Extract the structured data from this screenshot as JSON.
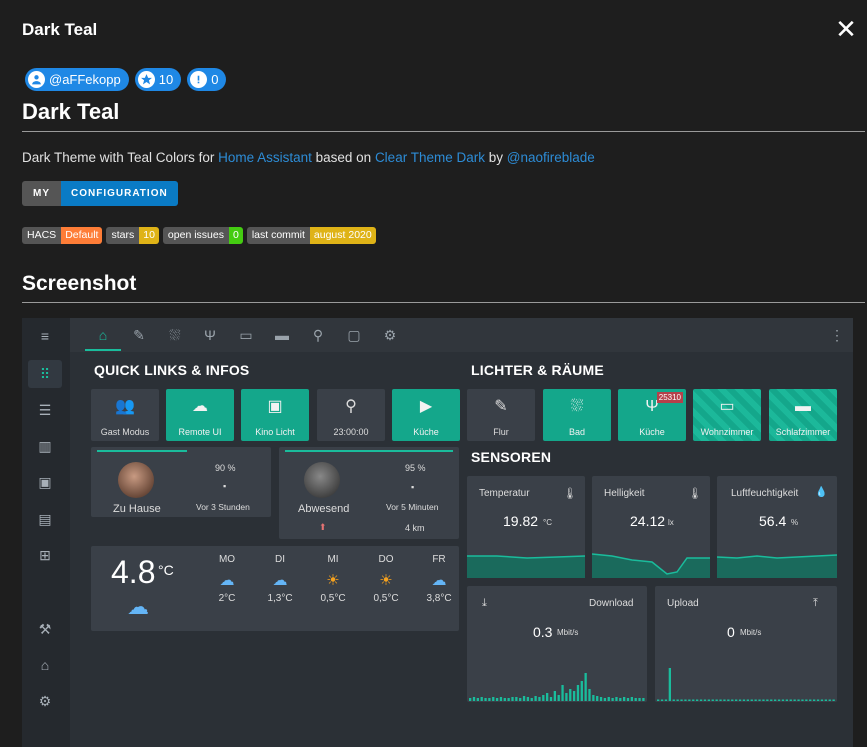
{
  "window": {
    "title": "Dark Teal",
    "close_icon": "close-icon"
  },
  "chips": [
    {
      "icon": "user-icon",
      "label": "@aFFekopp"
    },
    {
      "icon": "star-icon",
      "label": "10"
    },
    {
      "icon": "alert-icon",
      "label": "0"
    }
  ],
  "heading": "Dark Teal",
  "description": {
    "prefix": "Dark Theme with Teal Colors for ",
    "link1": "Home Assistant",
    "mid1": " based on ",
    "link2": "Clear Theme Dark",
    "mid2": " by ",
    "link3": "@naofireblade"
  },
  "my_config": {
    "left": "MY",
    "right": "CONFIGURATION"
  },
  "shields": [
    {
      "label": "HACS",
      "value": "Default",
      "color": "#fe7d37"
    },
    {
      "label": "stars",
      "value": "10",
      "color": "#dfb317"
    },
    {
      "label": "open issues",
      "value": "0",
      "color": "#4c1"
    },
    {
      "label": "last commit",
      "value": "august 2020",
      "color": "#dfb317"
    }
  ],
  "screenshot_heading": "Screenshot",
  "shot": {
    "accent": "#1abc9c",
    "quick_title": "QUICK LINKS & INFOS",
    "lights_title": "LICHTER & RÄUME",
    "sensors_title": "SENSOREN",
    "quick_buttons": [
      {
        "label": "Gast Modus",
        "style": "g"
      },
      {
        "label": "Remote UI",
        "style": "t"
      },
      {
        "label": "Kino Licht",
        "style": "t"
      },
      {
        "label": "23:00:00",
        "style": "g"
      },
      {
        "label": "Küche",
        "style": "t"
      }
    ],
    "room_buttons": [
      {
        "label": "Flur",
        "style": "g"
      },
      {
        "label": "Bad",
        "style": "t"
      },
      {
        "label": "Küche",
        "style": "t",
        "badge": "25310"
      },
      {
        "label": "Wohnzimmer",
        "style": "t"
      },
      {
        "label": "Schlafzimmer",
        "style": "t"
      }
    ],
    "persons": [
      {
        "name": "Zu Hause",
        "battery": "90 %",
        "since": "Vor 3 Stunden",
        "extra": ""
      },
      {
        "name": "Abwesend",
        "battery": "95 %",
        "since": "Vor 5 Minuten",
        "extra": "4 km"
      }
    ],
    "weather": {
      "temp": "4.8",
      "unit": "°C",
      "days": [
        {
          "d": "MO",
          "t": "2°C",
          "icon": "cloud"
        },
        {
          "d": "DI",
          "t": "1,3°C",
          "icon": "cloud"
        },
        {
          "d": "MI",
          "t": "0,5°C",
          "icon": "sun"
        },
        {
          "d": "DO",
          "t": "0,5°C",
          "icon": "sun"
        },
        {
          "d": "FR",
          "t": "3,8°C",
          "icon": "cloud"
        }
      ]
    },
    "sensors": [
      {
        "name": "Temperatur",
        "value": "19.82",
        "unit": "°C"
      },
      {
        "name": "Helligkeit",
        "value": "24.12",
        "unit": "lx"
      },
      {
        "name": "Luftfeuchtigkeit",
        "value": "56.4",
        "unit": "%"
      }
    ],
    "network": [
      {
        "name": "Download",
        "value": "0.3",
        "unit": "Mbit/s"
      },
      {
        "name": "Upload",
        "value": "0",
        "unit": "Mbit/s"
      }
    ]
  }
}
